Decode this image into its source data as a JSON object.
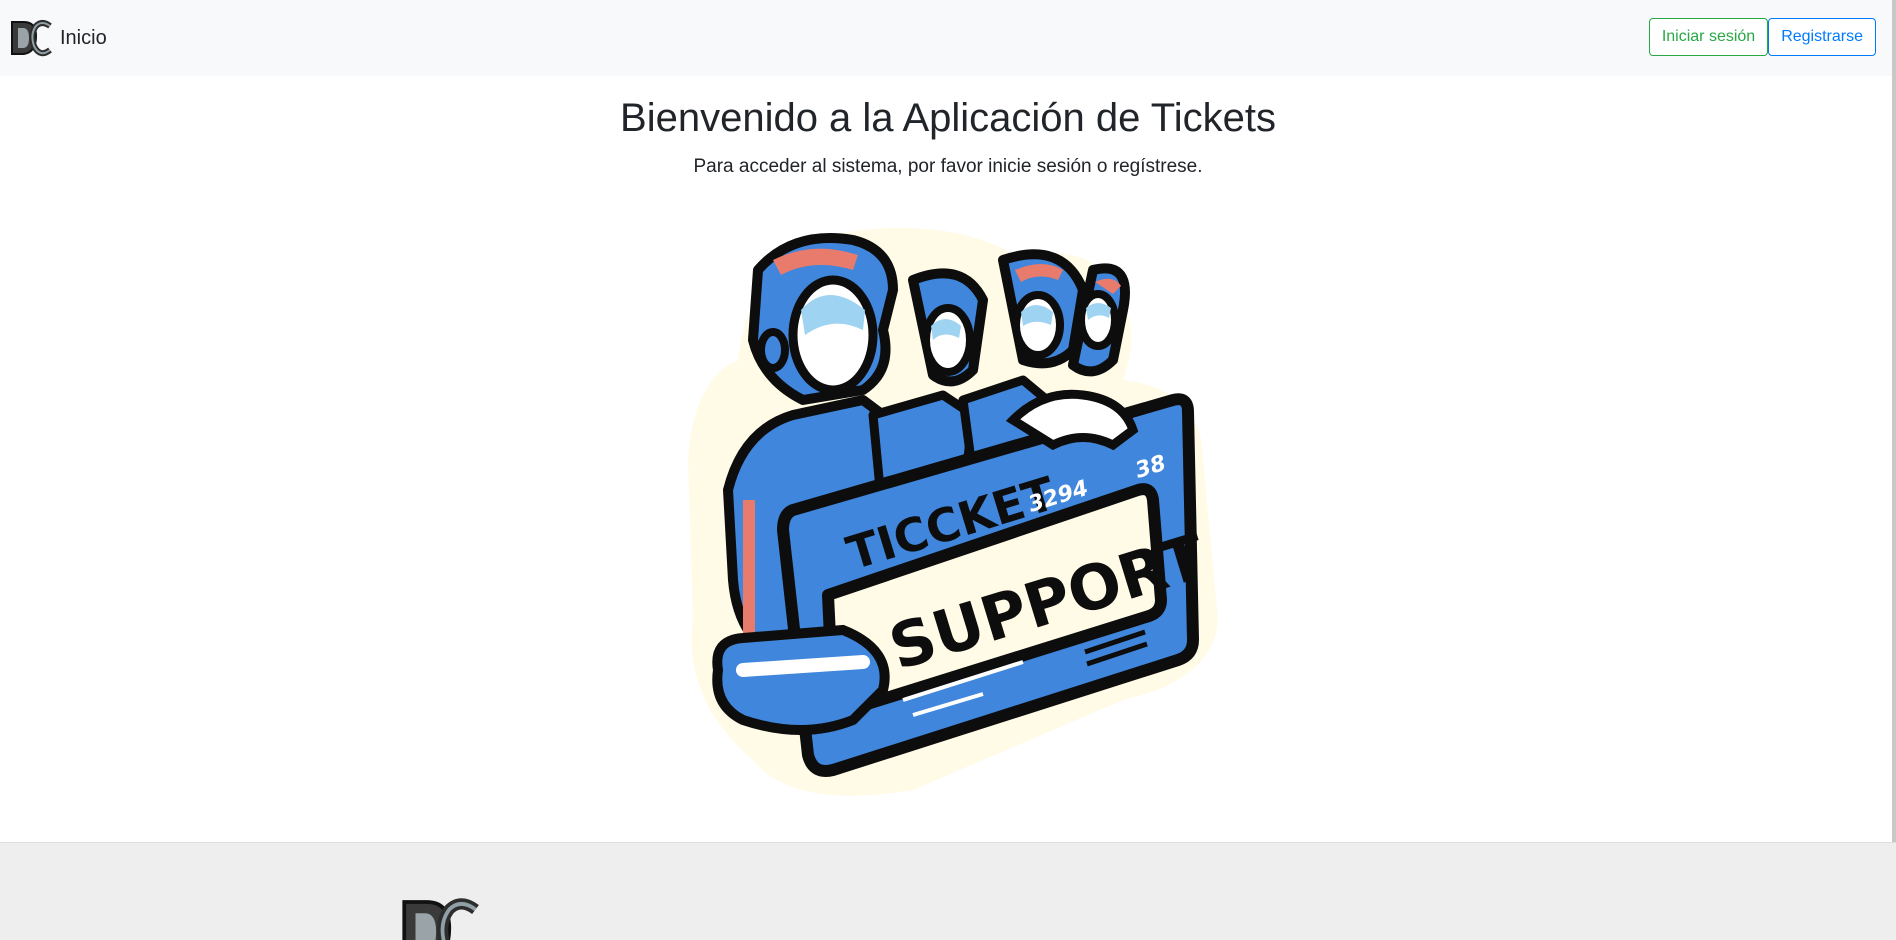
{
  "navbar": {
    "brand_label": "Inicio",
    "brand_logo_icon": "dc-monogram-logo",
    "login_label": "Iniciar sesión",
    "register_label": "Registrarse"
  },
  "main": {
    "title": "Bienvenido a la Aplicación de Tickets",
    "subtitle": "Para acceder al sistema, por favor inicie sesión o regístrese.",
    "hero_image": {
      "icon": "ticket-support-illustration",
      "ticket_word": "TICCKET",
      "ticket_number_left": "3294",
      "ticket_number_right": "38",
      "main_word": "SUPPORT"
    }
  },
  "footer": {
    "logo_icon": "dc-monogram-logo"
  },
  "colors": {
    "navbar_bg": "#f8f9fa",
    "login_accent": "#28a745",
    "register_accent": "#007bff",
    "footer_bg": "#eeeeee",
    "illustration_blue": "#3f86dc",
    "illustration_salmon": "#e87b6c",
    "illustration_cream": "#fffbe6"
  }
}
